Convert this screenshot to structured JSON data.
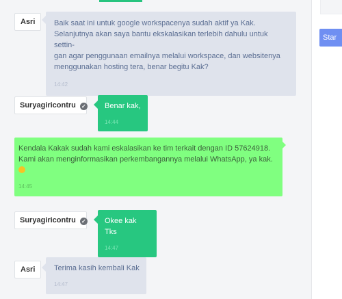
{
  "messages": [
    {
      "sender": "Asri",
      "text": "Baik saat ini untuk google workspacenya sudah aktif ya Kak. Selanjutnya akan saya bantu ekskalasikan terlebih dahulu untuk settin-gan agar penggunaan emailnya melalui workspace, dan websitenya menggunakan hosting tera, benar begitu Kak?",
      "lines": [
        "Baik saat ini untuk google workspacenya sudah aktif ya Kak.",
        "Selanjutnya akan saya bantu ekskalasikan terlebih dahulu untuk settin-",
        "gan agar penggunaan emailnya melalui workspace, dan websitenya",
        "menggunakan hosting tera, benar begitu Kak?"
      ],
      "time": "14:42"
    },
    {
      "sender": "Suryagiricontru",
      "verified": true,
      "text": "Benar kak,",
      "time": "14:44"
    },
    {
      "sender": "",
      "lines": [
        "Kendala Kakak sudah kami eskalasikan ke tim terkait dengan ID 57624918.",
        "Kami akan menginformasikan perkembangannya melalui WhatsApp, ya kak."
      ],
      "emoji": "smiley-icon",
      "time": "14:45"
    },
    {
      "sender": "Suryagiricontru",
      "verified": true,
      "text": "Okee kak Tks",
      "time": "14:47"
    },
    {
      "sender": "Asri",
      "text": "Terima kasih kembali Kak",
      "time": "14:47"
    }
  ],
  "sidebar": {
    "button_label": "Star"
  },
  "colors": {
    "agent_bubble": "#dfe3ec",
    "customer_bubble": "#27c780",
    "system_bubble": "#80ff80",
    "sidebar_button": "#6f8ff2"
  }
}
